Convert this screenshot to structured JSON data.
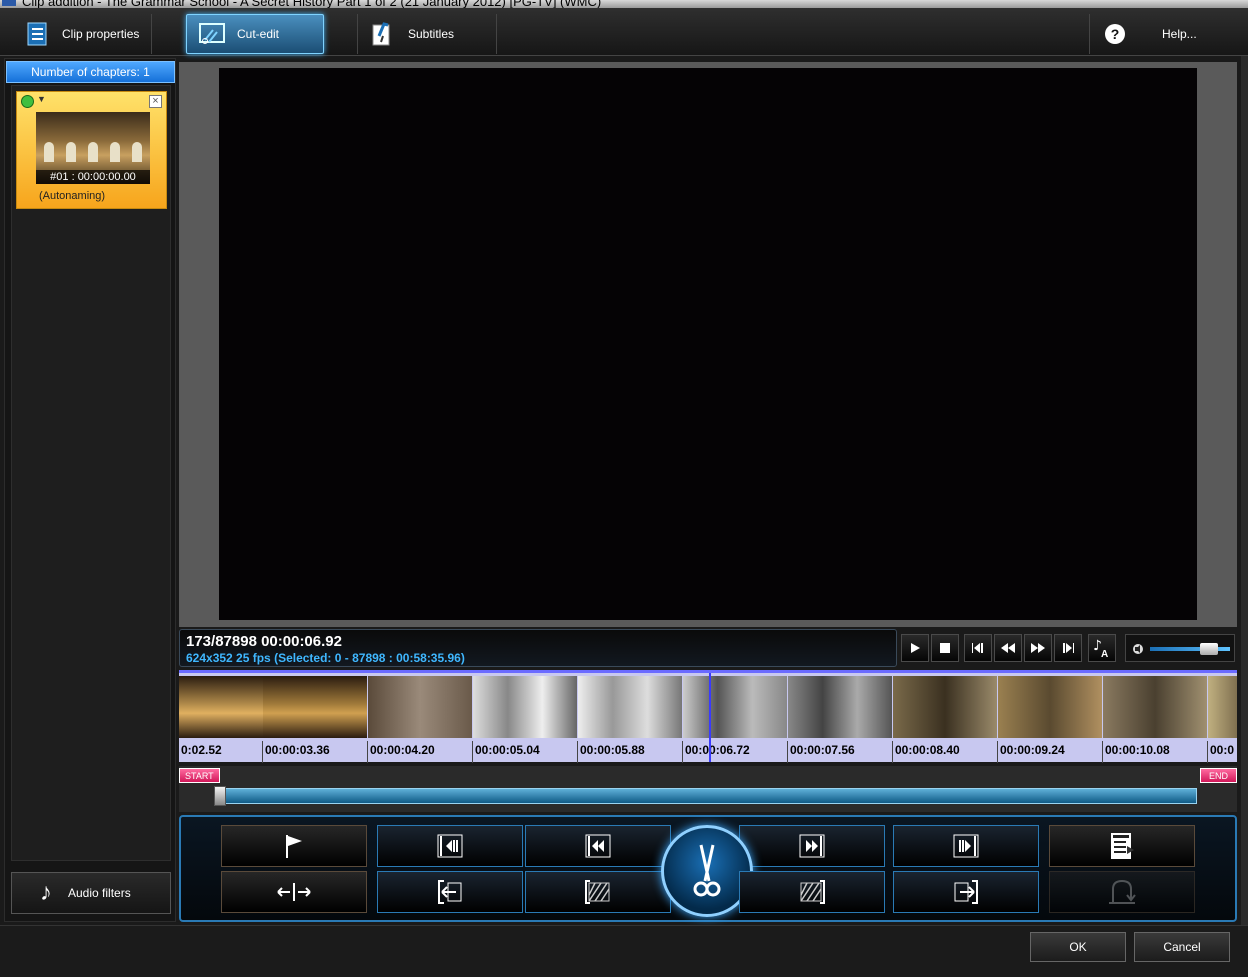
{
  "window": {
    "title": "Clip addition - The Grammar School - A Secret History Part 1 of 2 (21 January 2012) [PG-TV] (WMC)"
  },
  "toolbar": {
    "clip_properties_label": "Clip properties",
    "cut_edit_label": "Cut-edit",
    "subtitles_label": "Subtitles",
    "help_label": "Help..."
  },
  "chapters": {
    "header": "Number of chapters: 1",
    "items": [
      {
        "code": "#01 : 00:00:00.00",
        "name": "(Autonaming)"
      }
    ]
  },
  "audio_filters_label": "Audio filters",
  "info": {
    "frame": "173/87898  00:00:06.92",
    "details": "624x352 25  fps  (Selected: 0 - 87898 : 00:58:35.96)"
  },
  "timeline": {
    "ticks": [
      "0:02.52",
      "00:00:03.36",
      "00:00:04.20",
      "00:00:05.04",
      "00:00:05.88",
      "00:00:06.72",
      "00:00:07.56",
      "00:00:08.40",
      "00:00:09.24",
      "00:00:10.08",
      "00:0"
    ]
  },
  "range": {
    "start_label": "START",
    "end_label": "END"
  },
  "dialog": {
    "ok_label": "OK",
    "cancel_label": "Cancel"
  },
  "colors": {
    "accent": "#2a7ab5",
    "active_tab": "#4a8fbf",
    "chapter_card": "#f7c23a",
    "info_text": "#3fb7ff"
  }
}
